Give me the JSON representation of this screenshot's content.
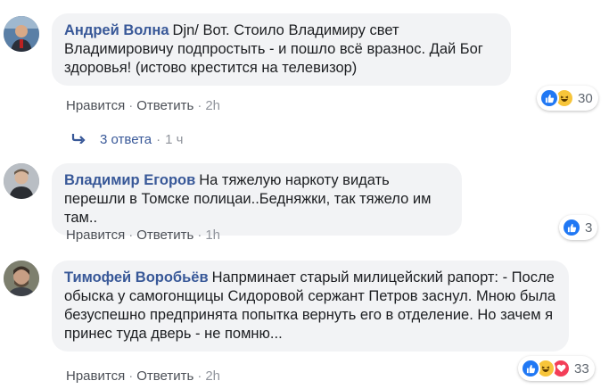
{
  "comments": [
    {
      "author": "Андрей Волна",
      "text": "Djn/ Вот. Стоило Владимиру свет Владимировичу подпростыть - и пошло всё вразнос. Дай Бог здоровья! (истово крестится на телевизор)",
      "like_label": "Нравится",
      "reply_label": "Ответить",
      "time": "2h",
      "reaction_count": "30",
      "reactions": [
        "like",
        "haha"
      ]
    },
    {
      "author": "Владимир Егоров",
      "text": "На тяжелую наркоту видать перешли в Томске полицаи..Бедняжки, так тяжело им там..",
      "like_label": "Нравится",
      "reply_label": "Ответить",
      "time": "1h",
      "reaction_count": "3",
      "reactions": [
        "like"
      ]
    },
    {
      "author": "Тимофей Воробьёв",
      "text": "Напрминает старый милицейский рапорт: - После обыска у самогонщицы Сидоровой сержант Петров заснул. Мною была безуспешно предпринята попытка вернуть его в отделение. Но зачем я принес туда дверь - не помню...",
      "like_label": "Нравится",
      "reply_label": "Ответить",
      "time": "2h",
      "reaction_count": "33",
      "reactions": [
        "like",
        "haha",
        "love"
      ]
    }
  ],
  "replies_link": {
    "label": "3 ответа",
    "time": "1 ч"
  },
  "separator": "·",
  "colors": {
    "author": "#385898",
    "bubble": "#f2f3f5",
    "like": "#2078f4",
    "haha": "#f7c53a",
    "love": "#f33e58"
  }
}
